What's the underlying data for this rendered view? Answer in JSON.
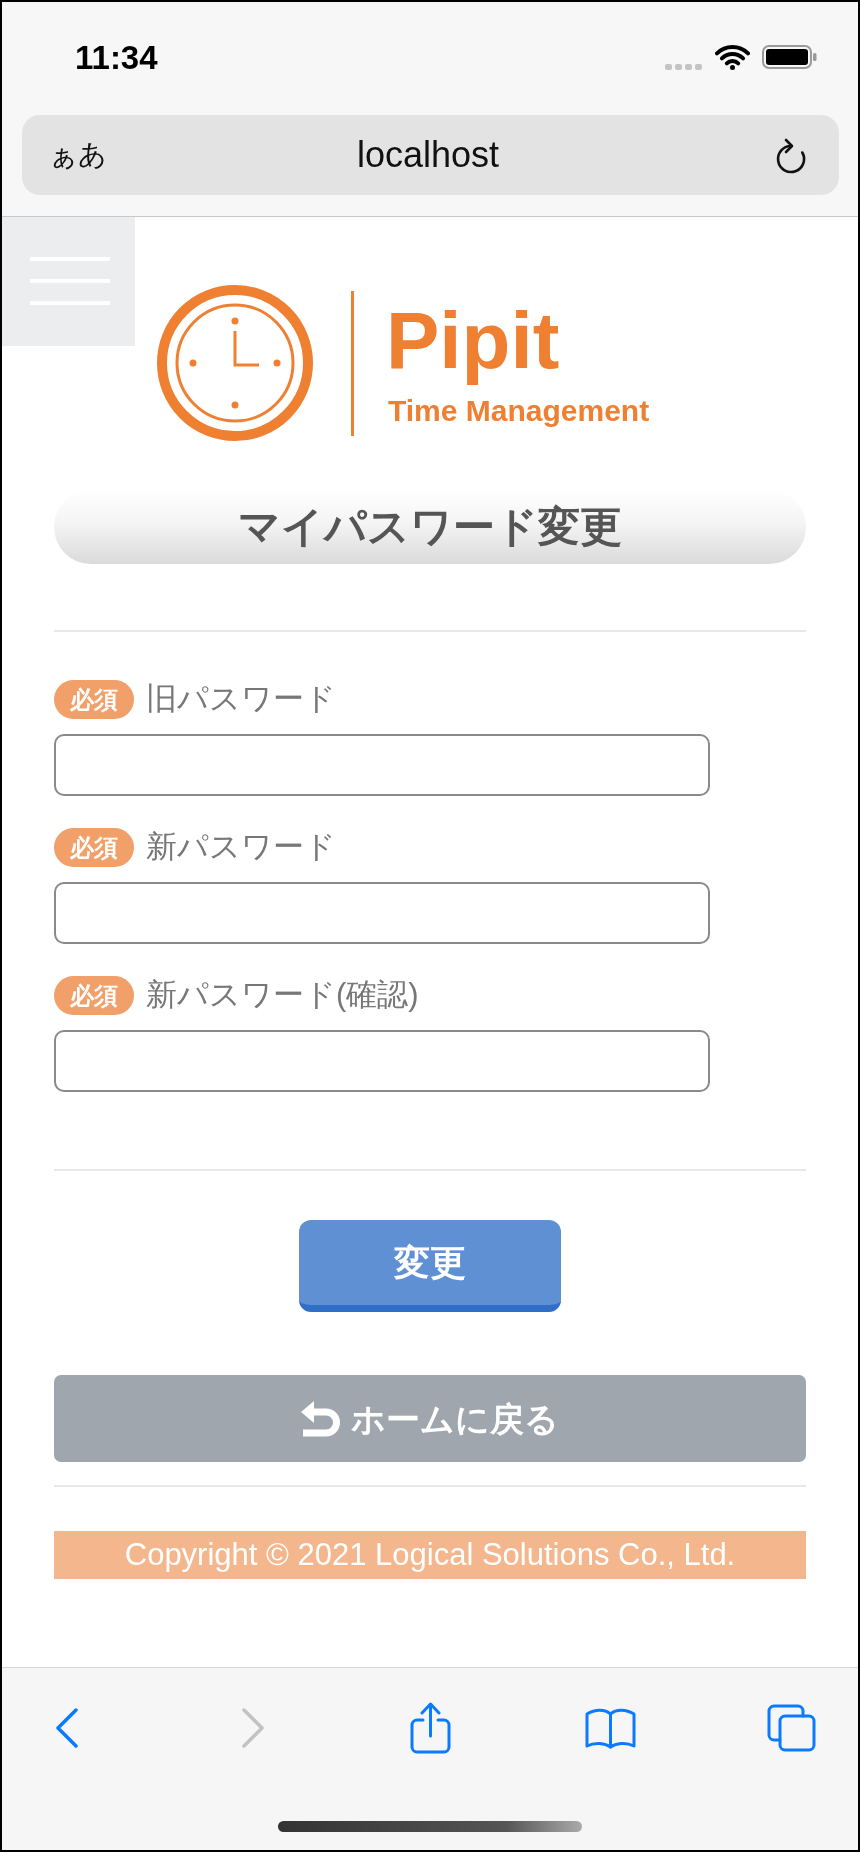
{
  "status_bar": {
    "time": "11:34"
  },
  "address_bar": {
    "text_size_label": "ぁあ",
    "url": "localhost"
  },
  "logo": {
    "name": "Pipit",
    "tagline": "Time Management"
  },
  "page_title": "マイパスワード変更",
  "form": {
    "fields": [
      {
        "required_badge": "必須",
        "label": "旧パスワード"
      },
      {
        "required_badge": "必須",
        "label": "新パスワード"
      },
      {
        "required_badge": "必須",
        "label": "新パスワード(確認)"
      }
    ]
  },
  "buttons": [
    {
      "kind": "submit",
      "label": "変更"
    },
    {
      "kind": "back",
      "label": "ホームに戻る"
    }
  ],
  "footer": {
    "copyright": "Copyright © 2021 Logical Solutions Co., Ltd."
  },
  "toolbar": {
    "items": [
      {
        "kind": "back",
        "disabled": false
      },
      {
        "kind": "forward",
        "disabled": true
      },
      {
        "kind": "share",
        "disabled": false
      },
      {
        "kind": "bookmarks",
        "disabled": false
      },
      {
        "kind": "tabs",
        "disabled": false
      }
    ]
  }
}
